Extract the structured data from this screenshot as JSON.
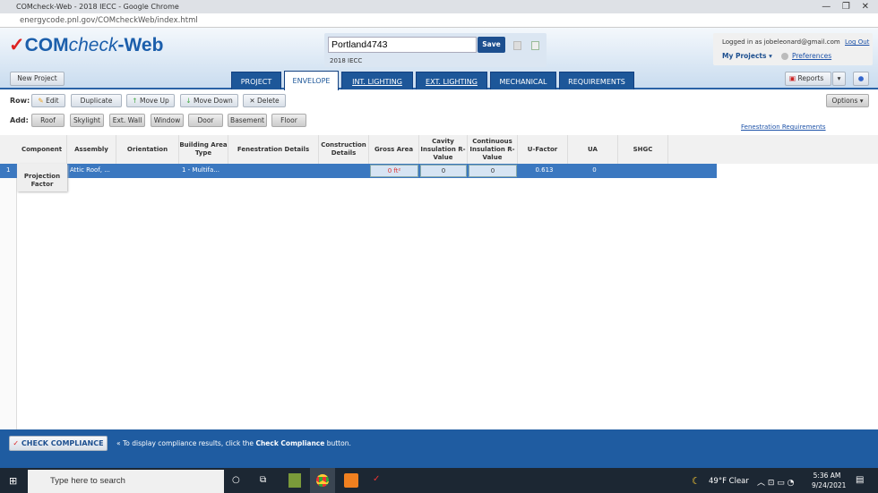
{
  "browser": {
    "title": "COMcheck-Web - 2018 IECC - Google Chrome",
    "url": "energycode.pnl.gov/COMcheckWeb/index.html"
  },
  "app": {
    "logo": "COMcheck-Web",
    "project_name": "Portland4743",
    "save": "Save",
    "code": "2018 IECC",
    "new_project": "New Project",
    "logged_in": "Logged in as jobeleonard@gmail.com",
    "logout": "Log Out",
    "my_projects": "My Projects ▾",
    "preferences": "Preferences",
    "reports": "Reports",
    "options": "Options ▾"
  },
  "tabs": [
    "PROJECT",
    "ENVELOPE",
    "INT. LIGHTING",
    "EXT. LIGHTING",
    "MECHANICAL",
    "REQUIREMENTS"
  ],
  "row_label": "Row:",
  "row_buttons": [
    "Edit",
    "Duplicate",
    "Move Up",
    "Move Down",
    "Delete"
  ],
  "add_label": "Add:",
  "add_buttons": [
    "Roof",
    "Skylight",
    "Ext. Wall",
    "Window",
    "Door",
    "Basement",
    "Floor"
  ],
  "fen_req": "Fenestration Requirements",
  "columns": [
    "Component",
    "Assembly",
    "Orientation",
    "Building Area Type",
    "Fenestration Details",
    "Construction Details",
    "Gross Area",
    "Cavity Insulation R-Value",
    "Continuous Insulation R-Value",
    "U-Factor",
    "UA",
    "SHGC"
  ],
  "rows": [
    {
      "num": "1",
      "assembly": "Attic Roof, ...",
      "area_type": "1 - Multifa...",
      "gross_area": "0 ft²",
      "cavity": "0",
      "continuous": "0",
      "ufactor": "0.613",
      "ua": "0"
    }
  ],
  "projection_factor": "Projection Factor",
  "footer": {
    "check": "CHECK COMPLIANCE",
    "msg_pre": "To display compliance results, click the ",
    "msg_bold": "Check Compliance",
    "msg_post": " button."
  },
  "taskbar": {
    "search": "Type here to search",
    "weather": "49°F  Clear",
    "time": "5:36 AM",
    "date": "9/24/2021"
  }
}
